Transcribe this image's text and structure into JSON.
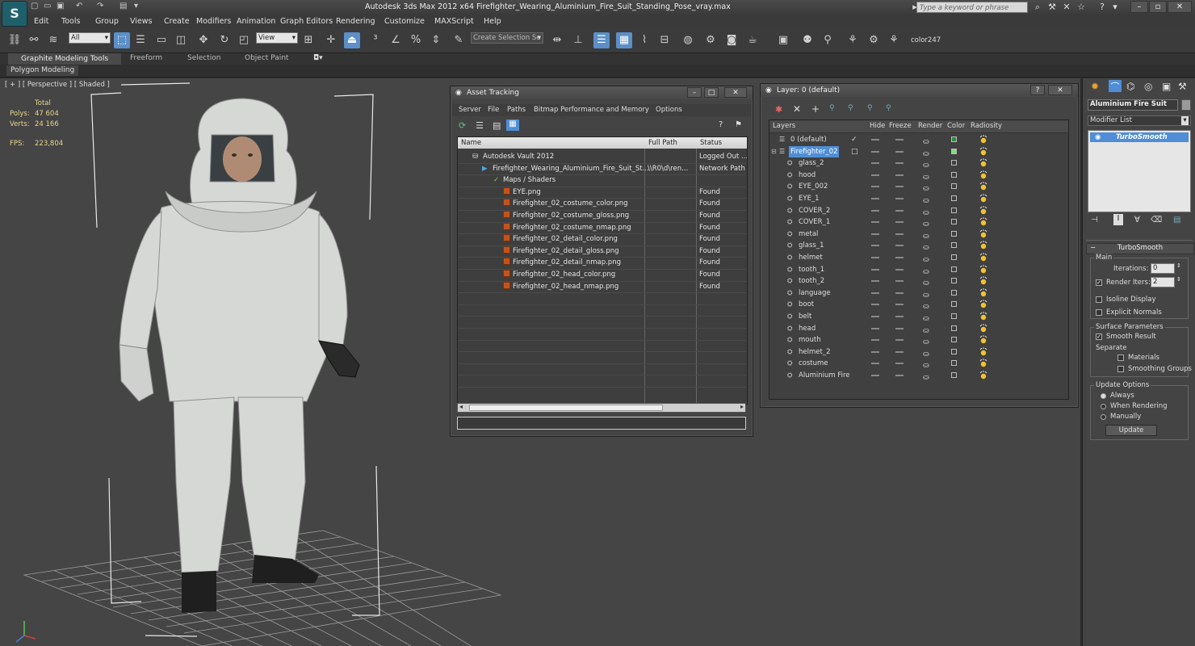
{
  "title_bar": {
    "app_title": "Autodesk 3ds Max  2012 x64     Firefighter_Wearing_Aluminium_Fire_Suit_Standing_Pose_vray.max",
    "search_placeholder": "Type a keyword or phrase"
  },
  "menu": [
    "Edit",
    "Tools",
    "Group",
    "Views",
    "Create",
    "Modifiers",
    "Animation",
    "Graph Editors",
    "Rendering",
    "Customize",
    "MAXScript",
    "Help"
  ],
  "toolbar": {
    "selection_filter": "All",
    "ref_coord": "View",
    "named_selection": "Create Selection Se",
    "color_label": "color247"
  },
  "ribbon": {
    "tabs": [
      "Graphite Modeling Tools",
      "Freeform",
      "Selection",
      "Object Paint"
    ],
    "sub_tab": "Polygon Modeling"
  },
  "viewport": {
    "label": "[ + ] [ Perspective ] [ Shaded ]",
    "stats": {
      "header": "Total",
      "polys_label": "Polys:",
      "polys": "47 604",
      "verts_label": "Verts:",
      "verts": "24 166",
      "fps_label": "FPS:",
      "fps": "223,804"
    }
  },
  "asset_tracking": {
    "title": "Asset Tracking",
    "menu": [
      "Server",
      "File",
      "Paths",
      "Bitmap Performance and Memory",
      "Options"
    ],
    "columns": [
      "Name",
      "Full Path",
      "Status"
    ],
    "rows": [
      {
        "name": "Autodesk Vault 2012",
        "path": "",
        "status": "Logged Out ..."
      },
      {
        "name": "Firefighter_Wearing_Aluminium_Fire_Suit_St...",
        "path": "\\\\R0\\d\\ren...",
        "status": "Network Path"
      },
      {
        "name": "Maps / Shaders",
        "path": "",
        "status": ""
      },
      {
        "name": "EYE.png",
        "path": "",
        "status": "Found"
      },
      {
        "name": "Firefighter_02_costume_color.png",
        "path": "",
        "status": "Found"
      },
      {
        "name": "Firefighter_02_costume_gloss.png",
        "path": "",
        "status": "Found"
      },
      {
        "name": "Firefighter_02_costume_nmap.png",
        "path": "",
        "status": "Found"
      },
      {
        "name": "Firefighter_02_detail_color.png",
        "path": "",
        "status": "Found"
      },
      {
        "name": "Firefighter_02_detail_gloss.png",
        "path": "",
        "status": "Found"
      },
      {
        "name": "Firefighter_02_detail_nmap.png",
        "path": "",
        "status": "Found"
      },
      {
        "name": "Firefighter_02_head_color.png",
        "path": "",
        "status": "Found"
      },
      {
        "name": "Firefighter_02_head_nmap.png",
        "path": "",
        "status": "Found"
      }
    ]
  },
  "layer_manager": {
    "title": "Layer: 0 (default)",
    "columns": [
      "Layers",
      "Hide",
      "Freeze",
      "Render",
      "Color",
      "Radiosity"
    ],
    "layers": [
      {
        "name": "0 (default)",
        "color": "#2e8a3a"
      },
      {
        "name": "Firefighter_02",
        "color": "#7ddc7d"
      },
      {
        "name": "glass_2"
      },
      {
        "name": "hood"
      },
      {
        "name": "EYE_002"
      },
      {
        "name": "EYE_1"
      },
      {
        "name": "COVER_2"
      },
      {
        "name": "COVER_1"
      },
      {
        "name": "metal"
      },
      {
        "name": "glass_1"
      },
      {
        "name": "helmet"
      },
      {
        "name": "tooth_1"
      },
      {
        "name": "tooth_2"
      },
      {
        "name": "language"
      },
      {
        "name": "boot"
      },
      {
        "name": "belt"
      },
      {
        "name": "head"
      },
      {
        "name": "mouth"
      },
      {
        "name": "helmet_2"
      },
      {
        "name": "costume"
      },
      {
        "name": "Aluminium Fire Su"
      }
    ]
  },
  "command_panel": {
    "object_name": "Aluminium Fire Suit",
    "modifier_list": "Modifier List",
    "stack_item": "TurboSmooth",
    "rollout_title": "TurboSmooth",
    "main_group": "Main",
    "iterations_label": "Iterations:",
    "iterations": "0",
    "render_iters_label": "Render Iters:",
    "render_iters": "2",
    "isoline_display": "Isoline Display",
    "explicit_normals": "Explicit Normals",
    "surface_group": "Surface Parameters",
    "smooth_result": "Smooth Result",
    "separate": "Separate",
    "materials": "Materials",
    "smoothing_groups": "Smoothing Groups",
    "update_group": "Update Options",
    "always": "Always",
    "when_rendering": "When Rendering",
    "manually": "Manually",
    "update_button": "Update"
  }
}
